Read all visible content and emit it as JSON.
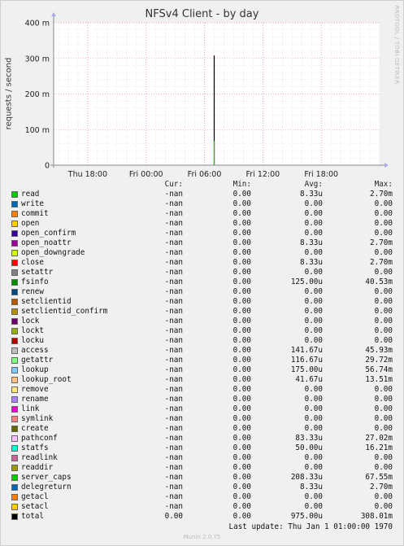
{
  "title": "NFSv4 Client - by day",
  "vertical_label": "RRDTOOL / TOBI OETIKER",
  "footer": "Last update: Thu Jan  1 01:00:00 1970",
  "munin": "Munin 2.0.75",
  "legend_header": {
    "cur": "Cur:",
    "min": "Min:",
    "avg": "Avg:",
    "max": "Max:"
  },
  "chart_data": {
    "type": "line",
    "title": "NFSv4 Client - by day",
    "ylabel": "requests / second",
    "ylim": [
      0,
      400
    ],
    "y_unit": "m",
    "y_ticks": [
      {
        "value": 0,
        "label": "0"
      },
      {
        "value": 100,
        "label": "100 m"
      },
      {
        "value": 200,
        "label": "200 m"
      },
      {
        "value": 300,
        "label": "300 m"
      },
      {
        "value": 400,
        "label": "400 m"
      }
    ],
    "x_range_hours": [
      -3.5,
      30
    ],
    "x_ticks": [
      {
        "value": 0,
        "label": "Thu 18:00"
      },
      {
        "value": 6,
        "label": "Fri 00:00"
      },
      {
        "value": 12,
        "label": "Fri 06:00"
      },
      {
        "value": 18,
        "label": "Fri 12:00"
      },
      {
        "value": 24,
        "label": "Fri 18:00"
      }
    ],
    "grid": true,
    "spikes": [
      {
        "name": "total",
        "x": 13.0,
        "value": 308.01,
        "color": "#000000"
      },
      {
        "name": "server_caps",
        "x": 13.0,
        "value": 67.55,
        "color": "#00CC00"
      }
    ],
    "series": [
      {
        "name": "read",
        "color": "#00CC00",
        "cur": "-nan",
        "min": "0.00",
        "avg": "8.33u",
        "max": "2.70m"
      },
      {
        "name": "write",
        "color": "#0066B3",
        "cur": "-nan",
        "min": "0.00",
        "avg": "0.00",
        "max": "0.00"
      },
      {
        "name": "commit",
        "color": "#FF8000",
        "cur": "-nan",
        "min": "0.00",
        "avg": "0.00",
        "max": "0.00"
      },
      {
        "name": "open",
        "color": "#FFCC00",
        "cur": "-nan",
        "min": "0.00",
        "avg": "0.00",
        "max": "0.00"
      },
      {
        "name": "open_confirm",
        "color": "#330099",
        "cur": "-nan",
        "min": "0.00",
        "avg": "0.00",
        "max": "0.00"
      },
      {
        "name": "open_noattr",
        "color": "#990099",
        "cur": "-nan",
        "min": "0.00",
        "avg": "8.33u",
        "max": "2.70m"
      },
      {
        "name": "open_downgrade",
        "color": "#CCFF00",
        "cur": "-nan",
        "min": "0.00",
        "avg": "0.00",
        "max": "0.00"
      },
      {
        "name": "close",
        "color": "#FF0000",
        "cur": "-nan",
        "min": "0.00",
        "avg": "8.33u",
        "max": "2.70m"
      },
      {
        "name": "setattr",
        "color": "#808080",
        "cur": "-nan",
        "min": "0.00",
        "avg": "0.00",
        "max": "0.00"
      },
      {
        "name": "fsinfo",
        "color": "#008F00",
        "cur": "-nan",
        "min": "0.00",
        "avg": "125.00u",
        "max": "40.53m"
      },
      {
        "name": "renew",
        "color": "#00487D",
        "cur": "-nan",
        "min": "0.00",
        "avg": "0.00",
        "max": "0.00"
      },
      {
        "name": "setclientid",
        "color": "#B35A00",
        "cur": "-nan",
        "min": "0.00",
        "avg": "0.00",
        "max": "0.00"
      },
      {
        "name": "setclientid_confirm",
        "color": "#B38F00",
        "cur": "-nan",
        "min": "0.00",
        "avg": "0.00",
        "max": "0.00"
      },
      {
        "name": "lock",
        "color": "#6B006B",
        "cur": "-nan",
        "min": "0.00",
        "avg": "0.00",
        "max": "0.00"
      },
      {
        "name": "lockt",
        "color": "#8FB300",
        "cur": "-nan",
        "min": "0.00",
        "avg": "0.00",
        "max": "0.00"
      },
      {
        "name": "locku",
        "color": "#B30000",
        "cur": "-nan",
        "min": "0.00",
        "avg": "0.00",
        "max": "0.00"
      },
      {
        "name": "access",
        "color": "#BEBEBE",
        "cur": "-nan",
        "min": "0.00",
        "avg": "141.67u",
        "max": "45.93m"
      },
      {
        "name": "getattr",
        "color": "#80FF80",
        "cur": "-nan",
        "min": "0.00",
        "avg": "116.67u",
        "max": "29.72m"
      },
      {
        "name": "lookup",
        "color": "#80C9FF",
        "cur": "-nan",
        "min": "0.00",
        "avg": "175.00u",
        "max": "56.74m"
      },
      {
        "name": "lookup_root",
        "color": "#FFC080",
        "cur": "-nan",
        "min": "0.00",
        "avg": "41.67u",
        "max": "13.51m"
      },
      {
        "name": "remove",
        "color": "#FFE680",
        "cur": "-nan",
        "min": "0.00",
        "avg": "0.00",
        "max": "0.00"
      },
      {
        "name": "rename",
        "color": "#AA80FF",
        "cur": "-nan",
        "min": "0.00",
        "avg": "0.00",
        "max": "0.00"
      },
      {
        "name": "link",
        "color": "#EE00CC",
        "cur": "-nan",
        "min": "0.00",
        "avg": "0.00",
        "max": "0.00"
      },
      {
        "name": "symlink",
        "color": "#FF8080",
        "cur": "-nan",
        "min": "0.00",
        "avg": "0.00",
        "max": "0.00"
      },
      {
        "name": "create",
        "color": "#666600",
        "cur": "-nan",
        "min": "0.00",
        "avg": "0.00",
        "max": "0.00"
      },
      {
        "name": "pathconf",
        "color": "#FFBFFF",
        "cur": "-nan",
        "min": "0.00",
        "avg": "83.33u",
        "max": "27.02m"
      },
      {
        "name": "statfs",
        "color": "#00FFCC",
        "cur": "-nan",
        "min": "0.00",
        "avg": "50.00u",
        "max": "16.21m"
      },
      {
        "name": "readlink",
        "color": "#CC6699",
        "cur": "-nan",
        "min": "0.00",
        "avg": "0.00",
        "max": "0.00"
      },
      {
        "name": "readdir",
        "color": "#999900",
        "cur": "-nan",
        "min": "0.00",
        "avg": "0.00",
        "max": "0.00"
      },
      {
        "name": "server_caps",
        "color": "#00CC00",
        "cur": "-nan",
        "min": "0.00",
        "avg": "208.33u",
        "max": "67.55m"
      },
      {
        "name": "delegreturn",
        "color": "#0066B3",
        "cur": "-nan",
        "min": "0.00",
        "avg": "8.33u",
        "max": "2.70m"
      },
      {
        "name": "getacl",
        "color": "#FF8000",
        "cur": "-nan",
        "min": "0.00",
        "avg": "0.00",
        "max": "0.00"
      },
      {
        "name": "setacl",
        "color": "#FFCC00",
        "cur": "-nan",
        "min": "0.00",
        "avg": "0.00",
        "max": "0.00"
      },
      {
        "name": "total",
        "color": "#000000",
        "cur": "0.00",
        "min": "0.00",
        "avg": "975.00u",
        "max": "308.01m"
      }
    ]
  }
}
